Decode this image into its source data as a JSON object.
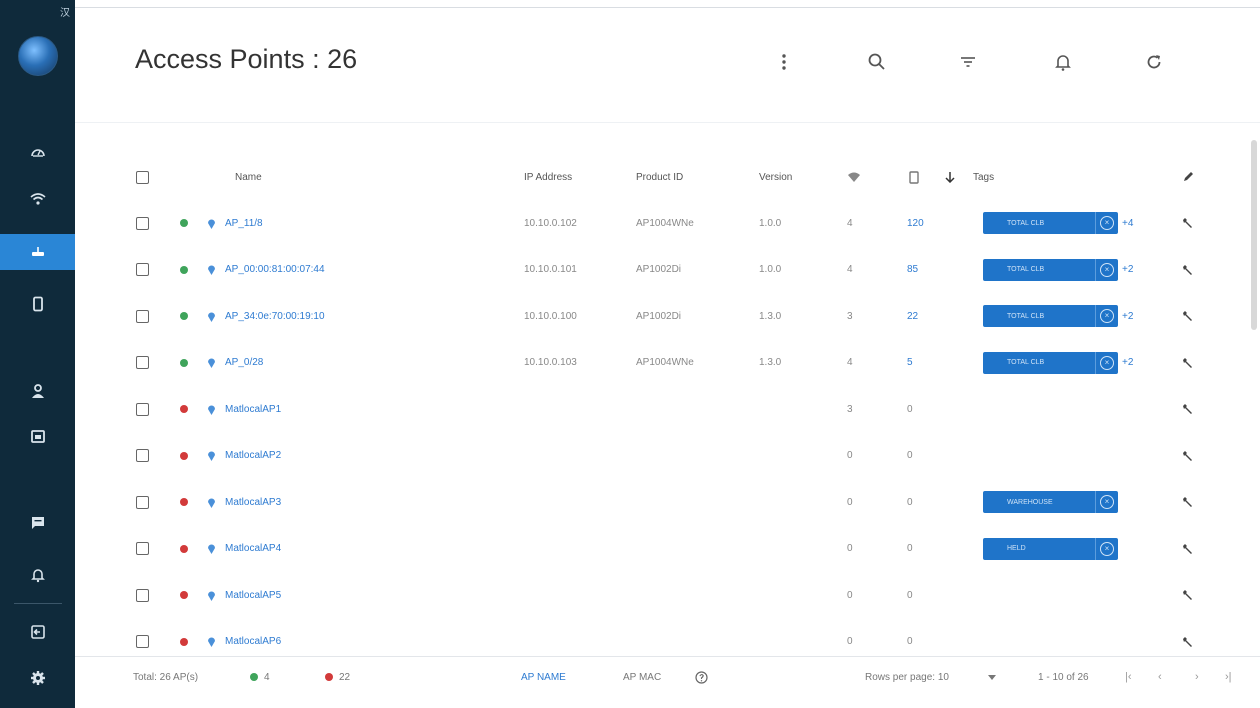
{
  "header": {
    "title": "Access Points : 26"
  },
  "sidebar": {
    "corner_glyph": "汉"
  },
  "colors": {
    "online": "#3fa45b",
    "offline": "#d23a3a",
    "accent": "#2a86d6",
    "tag_blue": "#1f74c9"
  },
  "table": {
    "columns": {
      "name": "Name",
      "ip": "IP Address",
      "product": "Product ID",
      "version": "Version",
      "wifi_icon": "wifi-icon",
      "device_icon": "phone-icon",
      "sort_icon": "arrow-down-icon",
      "tags": "Tags",
      "edit_icon": "pencil-icon"
    },
    "rows": [
      {
        "status": "online",
        "name": "AP_11/8",
        "ip": "10.10.0.102",
        "product": "AP1004WNe",
        "version": "1.0.0",
        "radios": "4",
        "clients": "120",
        "tag": "TOTAL CLB",
        "tag_more": "+4"
      },
      {
        "status": "online",
        "name": "AP_00:00:81:00:07:44",
        "ip": "10.10.0.101",
        "product": "AP1002Di",
        "version": "1.0.0",
        "radios": "4",
        "clients": "85",
        "tag": "TOTAL CLB",
        "tag_more": "+2"
      },
      {
        "status": "online",
        "name": "AP_34:0e:70:00:19:10",
        "ip": "10.10.0.100",
        "product": "AP1002Di",
        "version": "1.3.0",
        "radios": "3",
        "clients": "22",
        "tag": "TOTAL CLB",
        "tag_more": "+2"
      },
      {
        "status": "online",
        "name": "AP_0/28",
        "ip": "10.10.0.103",
        "product": "AP1004WNe",
        "version": "1.3.0",
        "radios": "4",
        "clients": "5",
        "tag": "TOTAL CLB",
        "tag_more": "+2"
      },
      {
        "status": "offline",
        "name": "MatlocalAP1",
        "ip": "",
        "product": "",
        "version": "",
        "radios": "3",
        "clients": "0",
        "tag": "",
        "tag_more": ""
      },
      {
        "status": "offline",
        "name": "MatlocalAP2",
        "ip": "",
        "product": "",
        "version": "",
        "radios": "0",
        "clients": "0",
        "tag": "",
        "tag_more": ""
      },
      {
        "status": "offline",
        "name": "MatlocalAP3",
        "ip": "",
        "product": "",
        "version": "",
        "radios": "0",
        "clients": "0",
        "tag": "WAREHOUSE",
        "tag_more": ""
      },
      {
        "status": "offline",
        "name": "MatlocalAP4",
        "ip": "",
        "product": "",
        "version": "",
        "radios": "0",
        "clients": "0",
        "tag": "HELD",
        "tag_more": ""
      },
      {
        "status": "offline",
        "name": "MatlocalAP5",
        "ip": "",
        "product": "",
        "version": "",
        "radios": "0",
        "clients": "0",
        "tag": "",
        "tag_more": ""
      },
      {
        "status": "offline",
        "name": "MatlocalAP6",
        "ip": "",
        "product": "",
        "version": "",
        "radios": "0",
        "clients": "0",
        "tag": "",
        "tag_more": ""
      }
    ]
  },
  "footer": {
    "total": "Total: 26 AP(s)",
    "online_count": "4",
    "offline_count": "22",
    "ap_name": "AP NAME",
    "ap_mac": "AP MAC",
    "rows_per_page": "Rows per page: 10",
    "range": "1 - 10 of 26"
  }
}
